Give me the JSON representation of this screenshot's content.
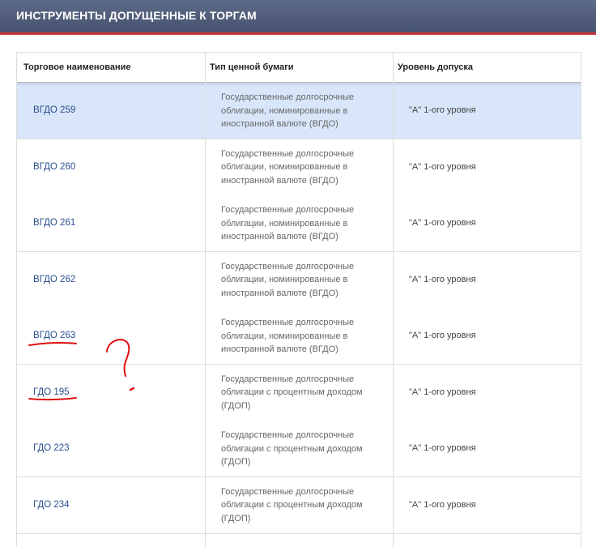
{
  "header": {
    "title": "ИНСТРУМЕНТЫ ДОПУЩЕННЫЕ К ТОРГАМ"
  },
  "table": {
    "columns": [
      "Торговое наименование",
      "Тип ценной бумаги",
      "Уровень допуска"
    ],
    "rows": [
      {
        "name": "ВГДО 259",
        "type": [
          "Государственные долгосрочные",
          "облигации, номинированные в",
          "иностранной валюте (ВГДО)"
        ],
        "level": "\"А\" 1-ого уровня",
        "active": true
      },
      {
        "name": "ВГДО 260",
        "type": [
          "Государственные долгосрочные",
          "облигации, номинированные в",
          "иностранной валюте (ВГДО)"
        ],
        "level": "\"А\" 1-ого уровня"
      },
      {
        "name": "ВГДО 261",
        "type": [
          "Государственные долгосрочные",
          "облигации, номинированные в",
          "иностранной валюте (ВГДО)"
        ],
        "level": "\"А\" 1-ого уровня"
      },
      {
        "name": "ВГДО 262",
        "type": [
          "Государственные долгосрочные",
          "облигации, номинированные в",
          "иностранной валюте (ВГДО)"
        ],
        "level": "\"А\" 1-ого уровня"
      },
      {
        "name": "ВГДО 263",
        "type": [
          "Государственные долгосрочные",
          "облигации, номинированные в",
          "иностранной валюте (ВГДО)"
        ],
        "level": "\"А\" 1-ого уровня"
      },
      {
        "name": "ГДО 195",
        "type": [
          "Государственные долгосрочные",
          "облигации с процентным доходом",
          "(ГДОП)"
        ],
        "level": "\"А\" 1-ого уровня"
      },
      {
        "name": "ГДО 223",
        "type": [
          "Государственные долгосрочные",
          "облигации с процентным доходом",
          "(ГДОП)"
        ],
        "level": "\"А\" 1-ого уровня"
      },
      {
        "name": "ГДО 234",
        "type": [
          "Государственные долгосрочные",
          "облигации с процентным доходом",
          "(ГДОП)"
        ],
        "level": "\"А\" 1-ого уровня"
      }
    ]
  },
  "annotation": {
    "color": "#e01010",
    "marks": [
      "underline",
      "underline",
      "question-mark"
    ]
  }
}
